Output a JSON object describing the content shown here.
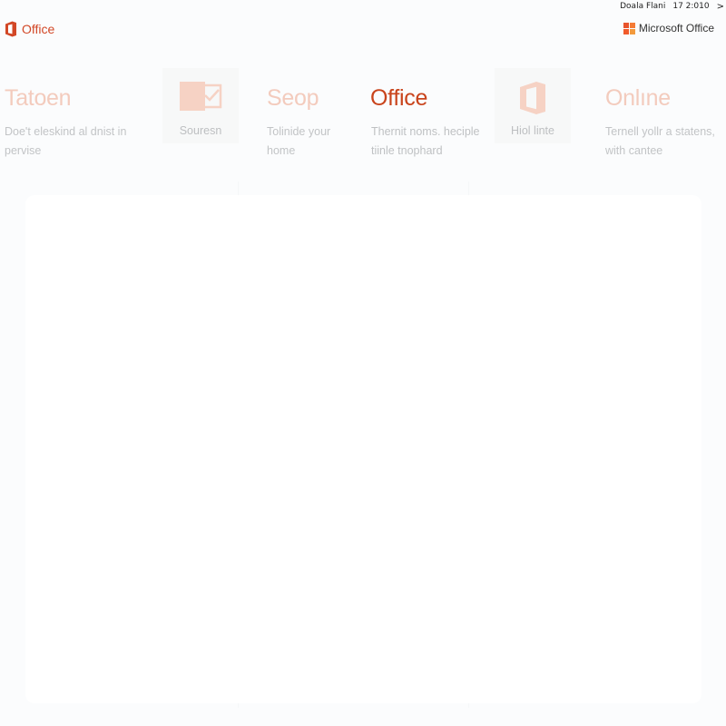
{
  "status_bar": {
    "left_text": "Doala Flani",
    "time_text": "17 2:010",
    "close_glyph": ">"
  },
  "header": {
    "brand_label": "Office",
    "ms_brand_label": "Microsoft Office"
  },
  "tiles": [
    {
      "heading": "Tatoen",
      "desc_line1": "Doe't eleskind al dnist in",
      "desc_line2": "pervise"
    },
    {
      "label": "Souresn",
      "icon": "outlook-icon"
    },
    {
      "heading": "Seop",
      "desc_line1": "Tolinide your",
      "desc_line2": "home"
    },
    {
      "heading": "Office",
      "desc_line1": "Thernit noms. heciple",
      "desc_line2": "tiinle tnophard"
    },
    {
      "label": "Hiol linte",
      "icon": "office-icon"
    },
    {
      "heading": "Onlıne",
      "desc_line1": "Ternell yollr a statens,",
      "desc_line2": "with cantee"
    }
  ],
  "colors": {
    "accent": "#d24726",
    "active_heading": "#c9441c",
    "faded_heading": "#f3cbbd",
    "icon_fill": "#f6d2c4"
  }
}
